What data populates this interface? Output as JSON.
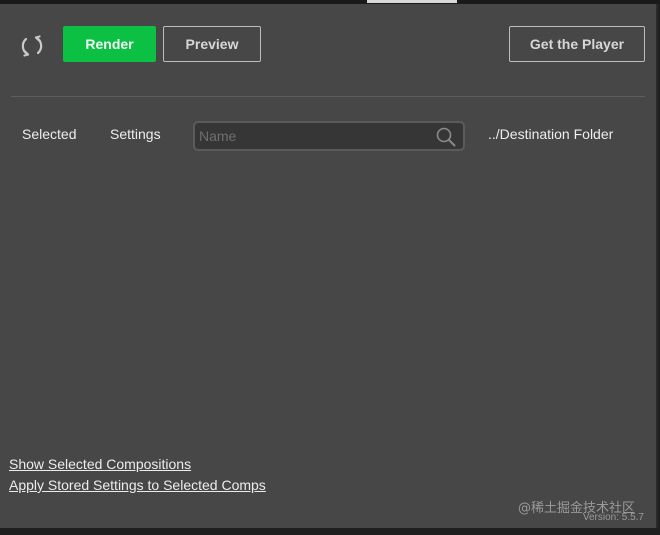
{
  "toolbar": {
    "refresh_icon": "refresh-icon",
    "render_label": "Render",
    "preview_label": "Preview",
    "get_player_label": "Get the Player",
    "render_color": "#0cc043"
  },
  "columns": {
    "selected_label": "Selected",
    "settings_label": "Settings",
    "search_placeholder": "Name",
    "search_value": "",
    "search_icon": "search-icon",
    "destination_label": "../Destination Folder"
  },
  "footer": {
    "show_selected_link": "Show Selected Compositions",
    "apply_settings_link": "Apply Stored Settings to Selected Comps",
    "version_text": "Version: 5.5.7"
  },
  "watermark": {
    "text": "@稀土掘金技术社区"
  }
}
